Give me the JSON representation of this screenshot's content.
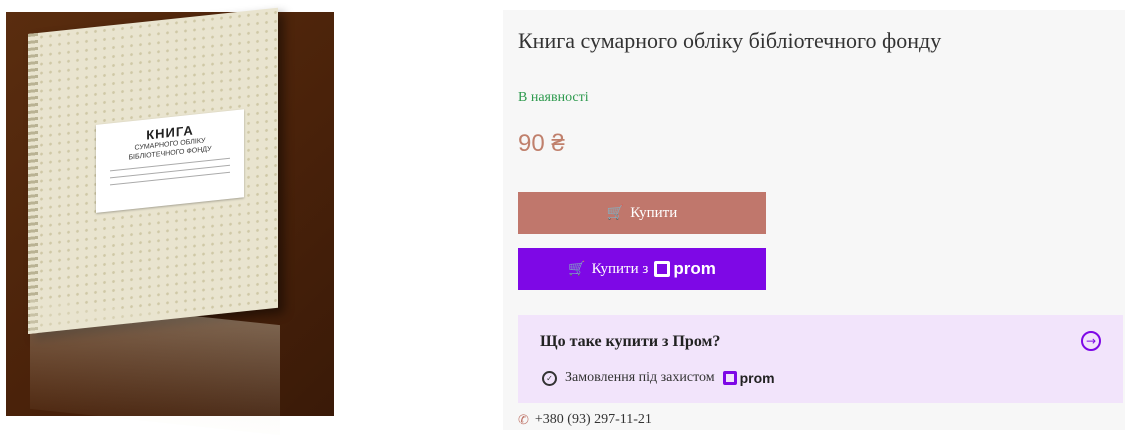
{
  "product": {
    "title": "Книга сумарного обліку бібліотечного фонду",
    "availability": "В наявності",
    "price": "90 ₴",
    "image": {
      "label_title": "КНИГА",
      "label_line1": "СУМАРНОГО ОБЛІКУ",
      "label_line2": "БІБЛІОТЕЧНОГО ФОНДУ"
    }
  },
  "buttons": {
    "buy_label": "Купити",
    "buy_with_prom_label": "Купити з",
    "prom_logo_text": "prom"
  },
  "prom_card": {
    "title": "Що таке купити з Пром?",
    "protection_text": "Замовлення під захистом",
    "prom_logo_text": "prom"
  },
  "contact": {
    "phone": "+380 (93) 297-11-21"
  },
  "icons": {
    "cart": "cart-icon",
    "arrow": "circle-arrow-right-icon",
    "shield": "shield-check-icon",
    "phone": "phone-icon"
  },
  "colors": {
    "availability": "#2e9a4e",
    "price": "#c0806c",
    "buy_button": "#c0776c",
    "prom_button": "#7e08e6",
    "prom_card_bg": "#f2e4fb"
  }
}
